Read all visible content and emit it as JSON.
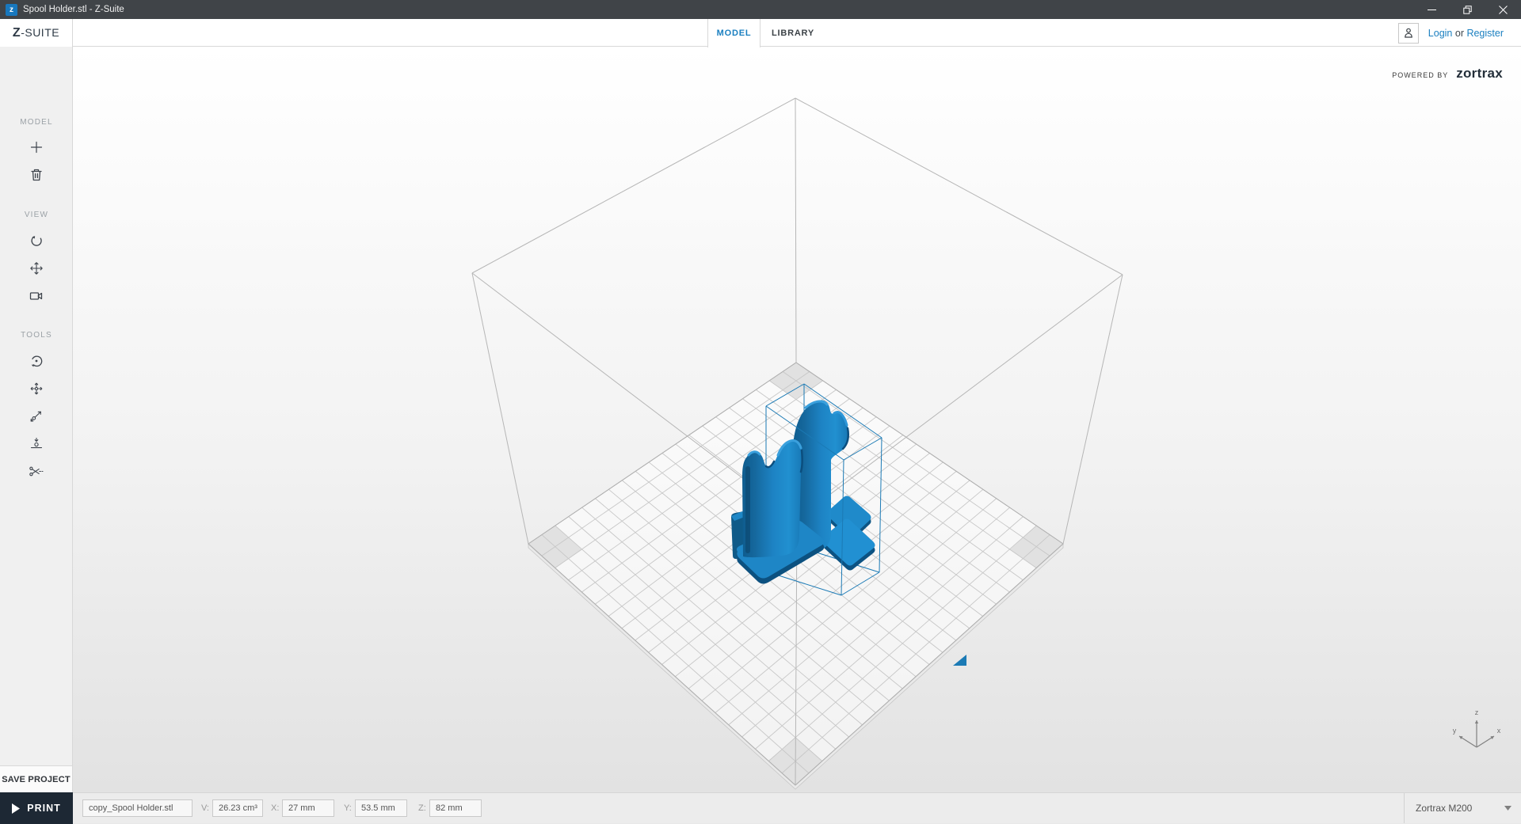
{
  "window": {
    "title": "Spool Holder.stl - Z-Suite",
    "app_icon_letter": "z",
    "controls": {
      "minimize": "minimize",
      "restore": "restore",
      "close": "close"
    }
  },
  "header": {
    "logo_z": "Z",
    "logo_rest": "-SUITE",
    "tabs": [
      {
        "label": "MODEL",
        "active": true
      },
      {
        "label": "LIBRARY",
        "active": false
      }
    ],
    "auth": {
      "login": "Login",
      "or": " or ",
      "register": "Register"
    }
  },
  "sidebar": {
    "sections": [
      {
        "label": "MODEL"
      },
      {
        "label": "VIEW"
      },
      {
        "label": "TOOLS"
      }
    ],
    "save_project": "SAVE PROJECT"
  },
  "viewport": {
    "powered_by": "POWERED BY",
    "brand": "zortrax",
    "axis_labels": {
      "x": "x",
      "y": "y",
      "z": "z"
    },
    "model_color": "#1d83c4",
    "selection_color": "#1b7ab5",
    "grid_line_color": "#c7c7c7",
    "cube_line_color": "#b6b6b6"
  },
  "statusbar": {
    "print": "PRINT",
    "filename": "copy_Spool Holder.stl",
    "fields": [
      {
        "label": "V:",
        "value": "26.23 cm³"
      },
      {
        "label": "X:",
        "value": "27 mm"
      },
      {
        "label": "Y:",
        "value": "53.5 mm"
      },
      {
        "label": "Z:",
        "value": "82 mm"
      }
    ],
    "printer": "Zortrax M200"
  }
}
